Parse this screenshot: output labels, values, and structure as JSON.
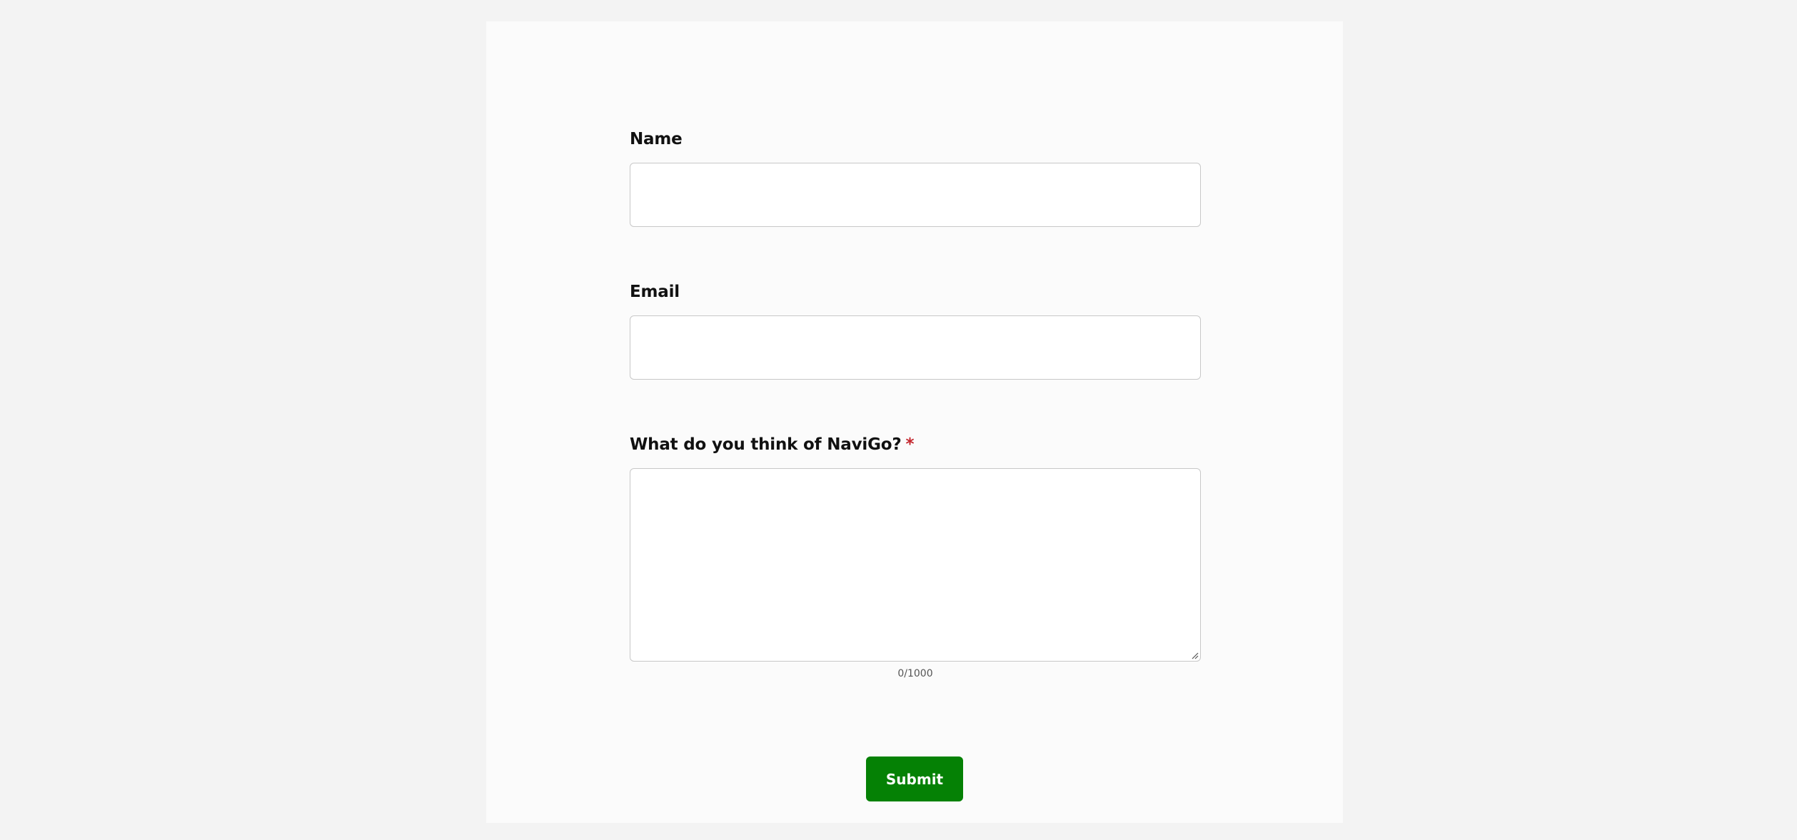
{
  "form": {
    "fields": [
      {
        "label": "Name",
        "value": ""
      },
      {
        "label": "Email",
        "value": ""
      },
      {
        "label": "What do you think of NaviGo?",
        "required_marker": "*",
        "value": ""
      }
    ],
    "char_counter": "0/1000",
    "submit_label": "Submit"
  },
  "colors": {
    "page_background": "#f3f3f3",
    "card_background": "#fbfbfb",
    "submit_button": "#058105",
    "required_marker": "#c4262e"
  }
}
